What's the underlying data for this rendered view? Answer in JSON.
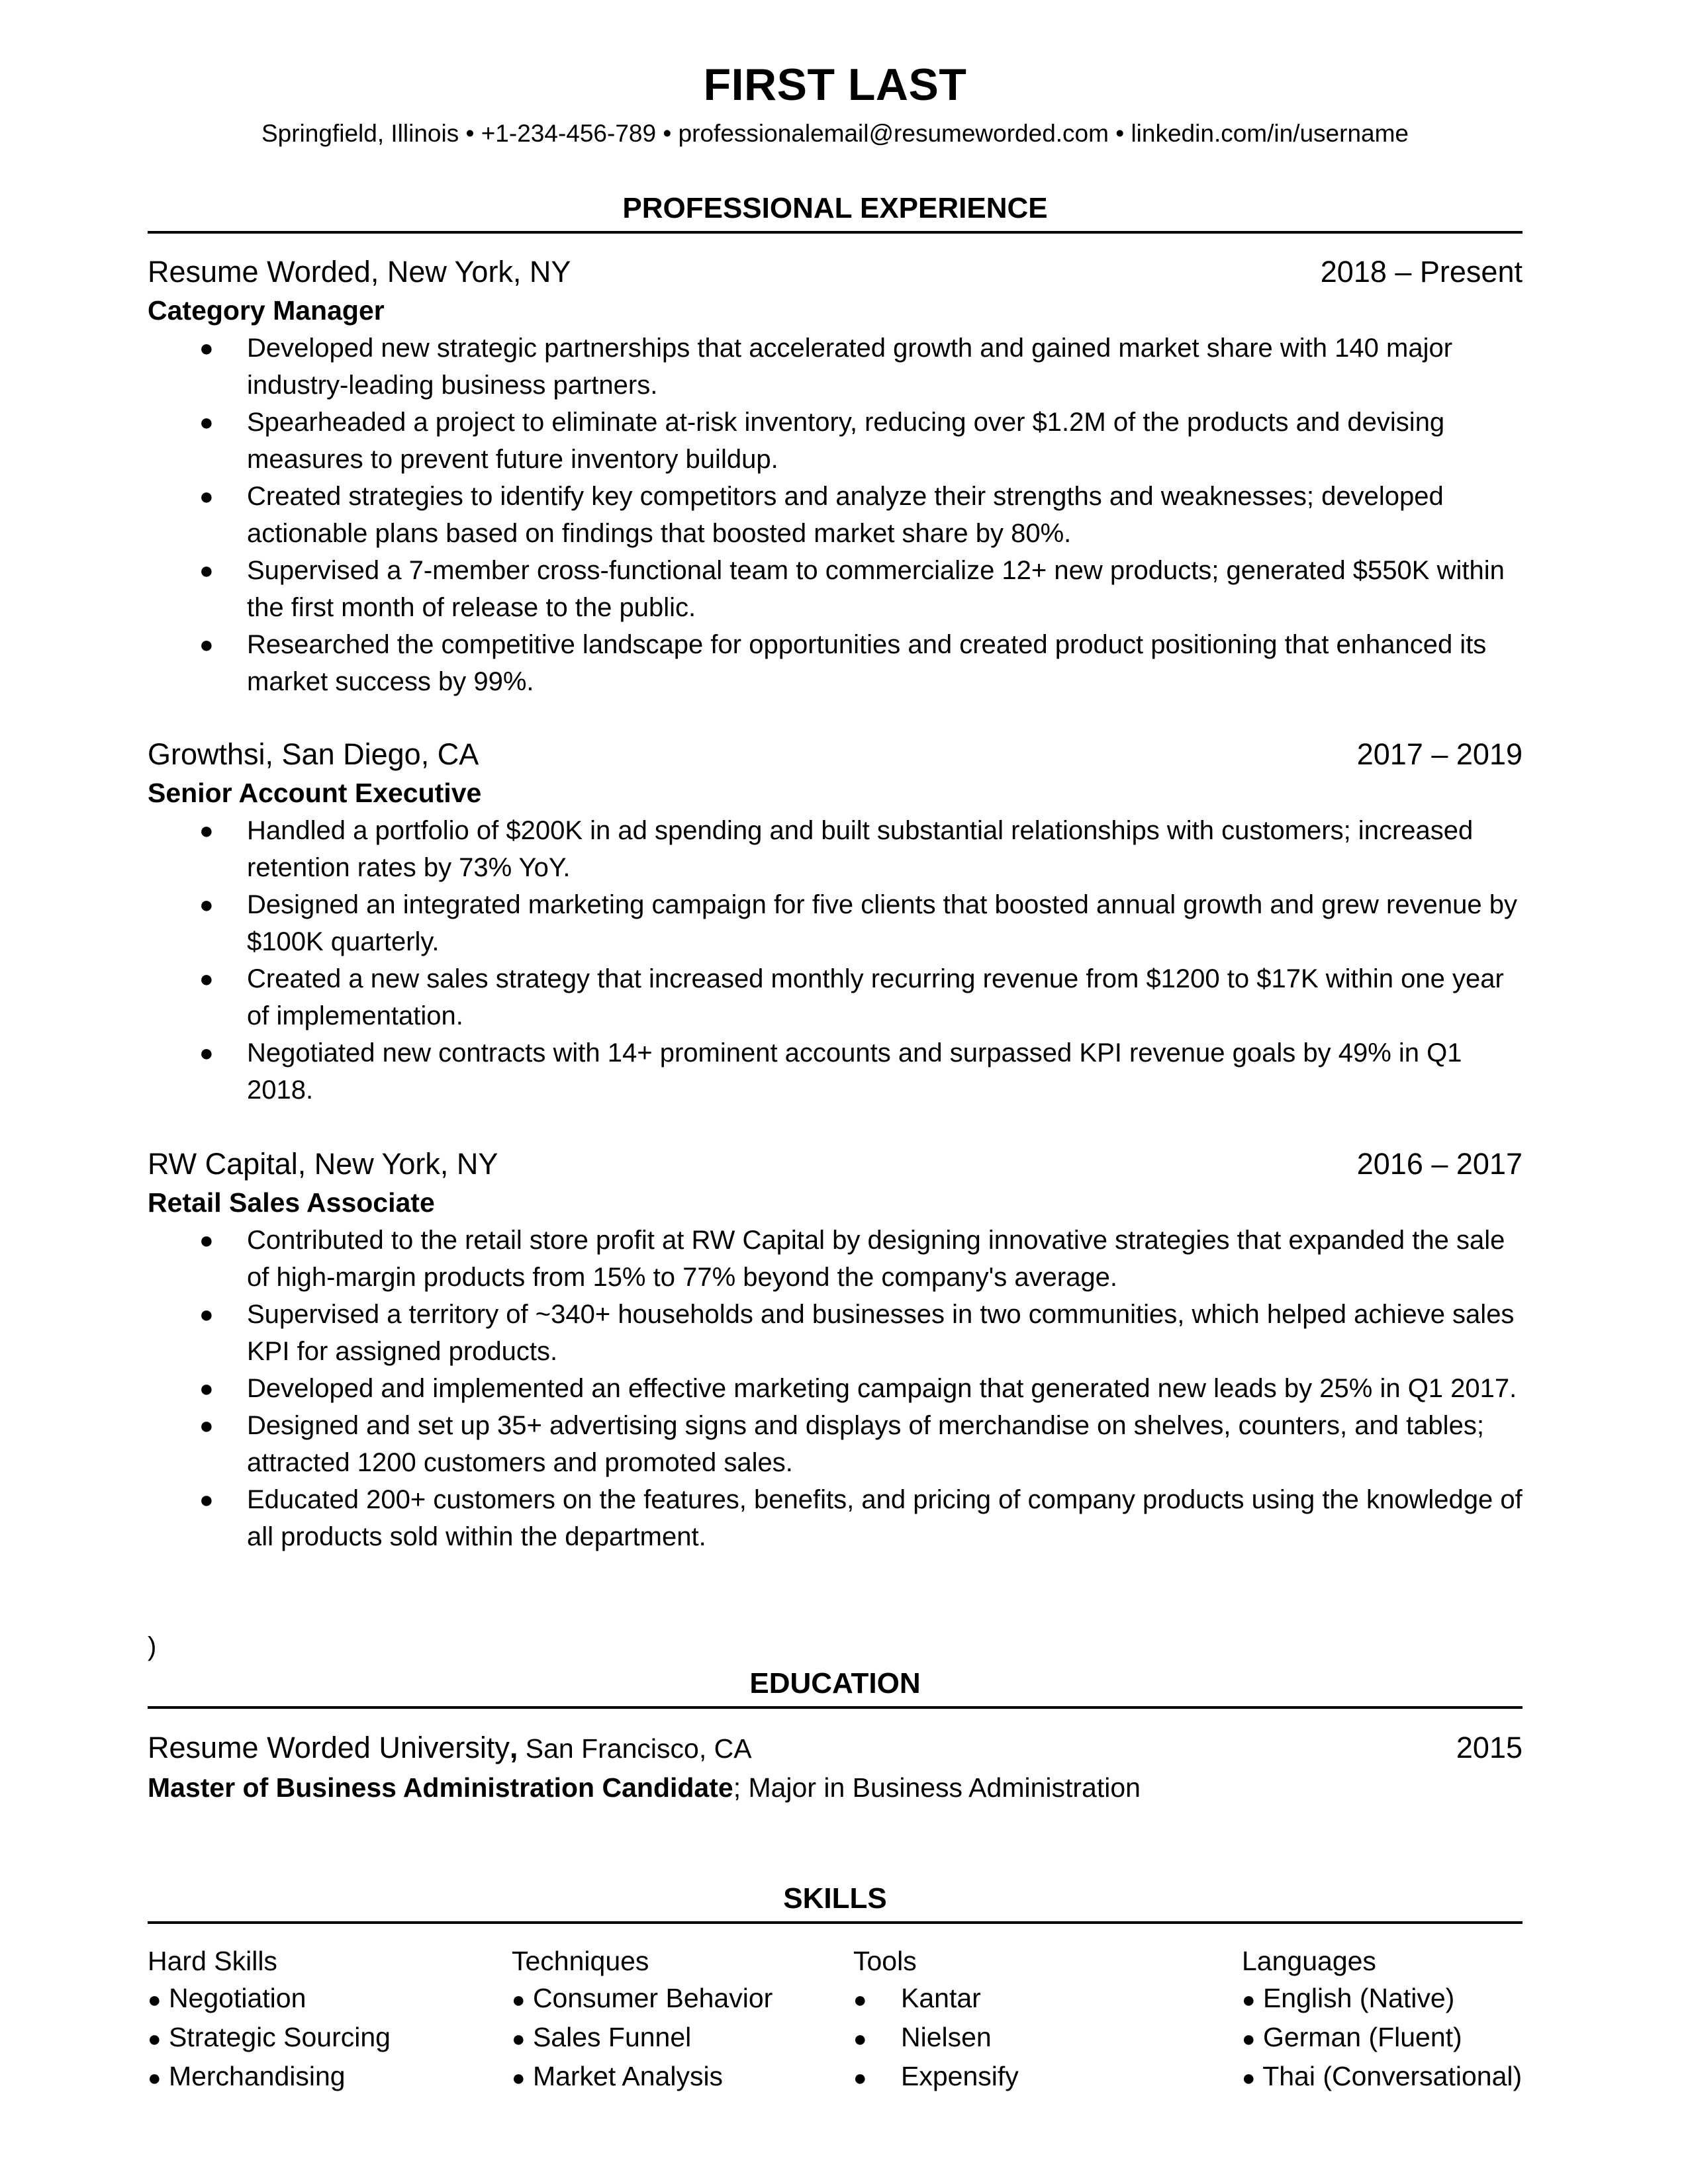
{
  "header": {
    "name": "FIRST LAST",
    "contact": "Springfield, Illinois • +1-234-456-789 • professionalemail@resumeworded.com • linkedin.com/in/username"
  },
  "experience": {
    "title": "PROFESSIONAL EXPERIENCE",
    "jobs": [
      {
        "company": "Resume Worded, New York, NY",
        "dates": "2018 – Present",
        "role": "Category Manager",
        "bullets": [
          "Developed new strategic partnerships that accelerated growth and gained market share with 140 major industry-leading business partners.",
          "Spearheaded a project to eliminate at-risk inventory, reducing over $1.2M of the products and devising measures to prevent future inventory buildup.",
          "Created strategies to identify key competitors and analyze their strengths and weaknesses; developed actionable plans based on findings that boosted market share by 80%.",
          "Supervised a 7-member cross-functional team to commercialize 12+ new products; generated $550K within the first month of release to the public.",
          "Researched the competitive landscape for opportunities and created product positioning that enhanced its market success by 99%."
        ]
      },
      {
        "company": "Growthsi, San Diego, CA",
        "dates": "2017 – 2019",
        "role": "Senior Account Executive",
        "bullets": [
          "Handled a portfolio of $200K in ad spending and built substantial relationships with customers; increased retention rates by 73% YoY.",
          "Designed an integrated marketing campaign for five clients that boosted annual growth and grew revenue by $100K quarterly.",
          "Created a new sales strategy that increased monthly recurring revenue from $1200 to $17K within one year of implementation.",
          "Negotiated new contracts with 14+ prominent accounts and surpassed KPI revenue goals by 49% in Q1 2018."
        ]
      },
      {
        "company": "RW Capital, New York, NY",
        "dates": "2016 – 2017",
        "role": "Retail Sales Associate",
        "bullets": [
          "Contributed to the retail store profit at RW Capital by designing innovative strategies that expanded the sale of high-margin products from 15% to 77% beyond the company's average.",
          "Supervised a territory of ~340+ households and businesses in two communities, which helped achieve sales KPI  for assigned products.",
          "Developed and implemented an effective marketing campaign that generated new leads by 25% in Q1 2017.",
          "Designed and set up 35+ advertising signs and displays of merchandise on shelves, counters, and tables;  attracted 1200 customers and promoted sales.",
          "Educated 200+ customers on the features, benefits, and pricing of company products using the knowledge of all products sold within the department."
        ]
      }
    ]
  },
  "stray_char": ")",
  "education": {
    "title": "EDUCATION",
    "school": "Resume Worded University",
    "school_sep": ",",
    "location": " San Francisco, CA",
    "year": "2015",
    "degree": "Master of Business Administration Candidate",
    "major": "; Major in Business Administration"
  },
  "skills": {
    "title": "SKILLS",
    "bullet": "●",
    "columns": [
      {
        "heading": "Hard Skills",
        "items": [
          "Negotiation",
          "Strategic Sourcing",
          "Merchandising"
        ]
      },
      {
        "heading": "Techniques",
        "items": [
          "Consumer Behavior",
          "Sales Funnel",
          "Market Analysis"
        ]
      },
      {
        "heading": "Tools",
        "items": [
          "Kantar",
          "Nielsen",
          "Expensify"
        ]
      },
      {
        "heading": "Languages",
        "items": [
          "English (Native)",
          "German (Fluent)",
          "Thai (Conversational)"
        ]
      }
    ]
  }
}
